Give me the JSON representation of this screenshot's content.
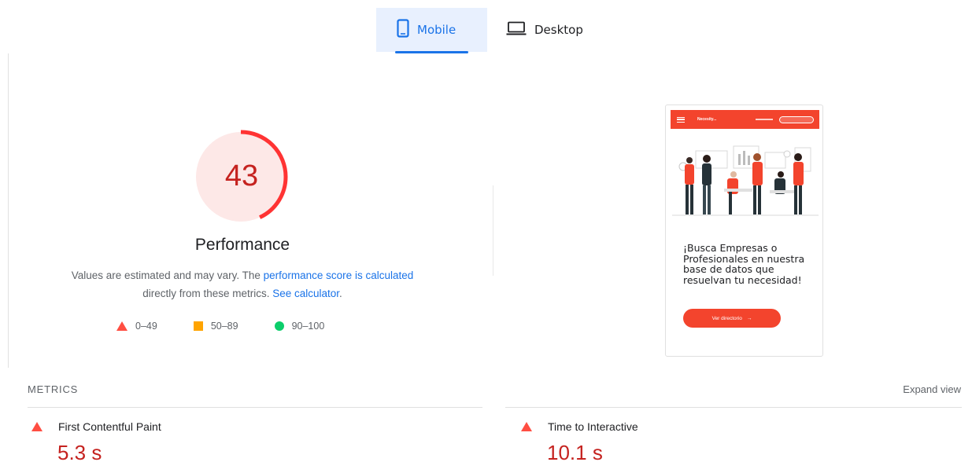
{
  "tabs": [
    {
      "label": "Mobile",
      "icon": "mobile-phone-icon",
      "active": true
    },
    {
      "label": "Desktop",
      "icon": "laptop-icon",
      "active": false
    }
  ],
  "performance": {
    "score": "43",
    "score_fraction": 0.43,
    "title": "Performance",
    "description_prefix": "Values are estimated and may vary. The ",
    "score_link": "performance score is calculated",
    "description_middle": " directly from these metrics. ",
    "calculator_link": "See calculator",
    "description_suffix": "."
  },
  "legend": [
    {
      "range": "0–49",
      "shape": "triangle",
      "color": "#ff4e42"
    },
    {
      "range": "50–89",
      "shape": "square",
      "color": "#ffa400"
    },
    {
      "range": "90–100",
      "shape": "circle",
      "color": "#0cce6b"
    }
  ],
  "screenshot": {
    "brand": "Necesity...",
    "headline": "¡Busca Empresas o Profesionales en nuestra base de datos que resuelvan tu necesidad!",
    "button_label": "Ver directorio",
    "accent_color": "#f3442d"
  },
  "metrics": {
    "label": "METRICS",
    "expand_label": "Expand view",
    "items": [
      {
        "name": "First Contentful Paint",
        "value": "5.3 s",
        "status": "fail"
      },
      {
        "name": "Time to Interactive",
        "value": "10.1 s",
        "status": "fail"
      }
    ]
  },
  "colors": {
    "accent_blue": "#1a73e8",
    "fail_red": "#c5221f",
    "gauge_red": "#ff3333",
    "gauge_fill": "#fde8e7"
  }
}
